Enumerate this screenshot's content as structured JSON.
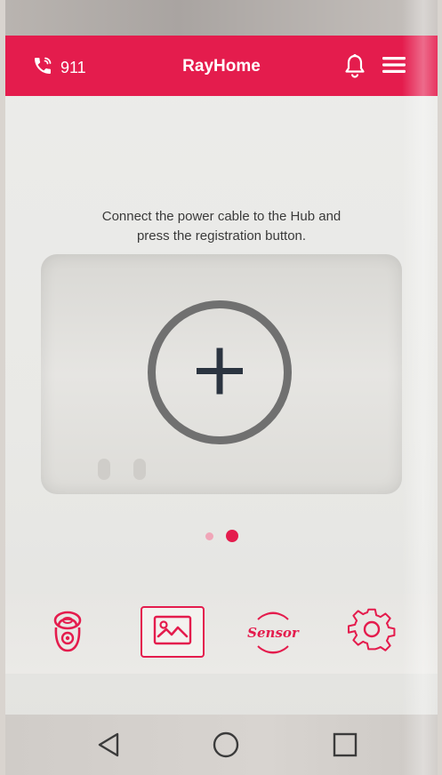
{
  "appbar": {
    "call_label": "911",
    "title": "RayHome",
    "accent_color": "#e41c4d",
    "icons": [
      "phone-icon",
      "bell-icon",
      "menu-icon"
    ]
  },
  "content": {
    "instruction_line1": "Connect the power cable to the Hub and",
    "instruction_line2": "press the registration button.",
    "register_icon": "plus-icon",
    "pager": {
      "total": 2,
      "active": 2
    }
  },
  "tabbar": {
    "tabs": [
      {
        "icon": "camera-icon",
        "selected": false
      },
      {
        "icon": "gallery-icon",
        "selected": true
      },
      {
        "icon": "sensor-icon",
        "label": "Sensor",
        "selected": false
      },
      {
        "icon": "gear-icon",
        "selected": false
      }
    ]
  },
  "navbar": {
    "icons": [
      "back-icon",
      "home-icon",
      "recent-apps-icon"
    ]
  }
}
